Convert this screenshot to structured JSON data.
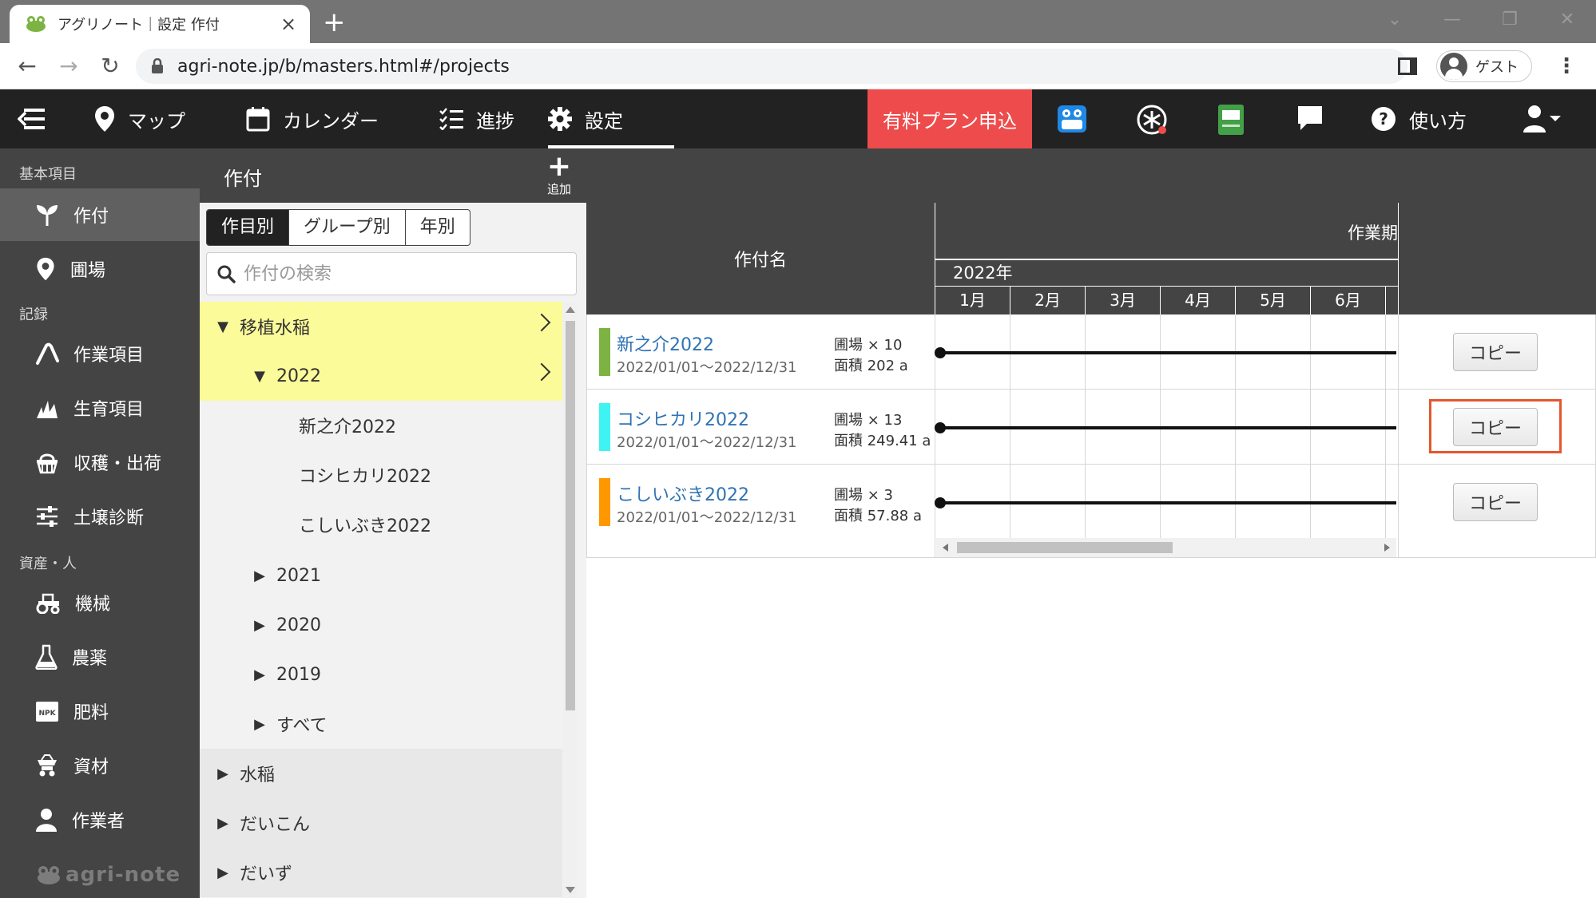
{
  "browser": {
    "tab_title": "アグリノート｜設定 作付",
    "url": "agri-note.jp/b/masters.html#/projects",
    "profile_label": "ゲスト"
  },
  "header": {
    "nav": [
      {
        "label": "マップ",
        "icon": "map-pin-icon"
      },
      {
        "label": "カレンダー",
        "icon": "calendar-icon"
      },
      {
        "label": "進捗",
        "icon": "checklist-icon"
      },
      {
        "label": "設定",
        "icon": "gear-icon",
        "active": true
      }
    ],
    "paid_plan_label": "有料プラン申込",
    "help_label": "使い方",
    "accent_red": "#ee4c4c"
  },
  "sidebar": {
    "sections": [
      {
        "title": "基本項目",
        "items": [
          {
            "label": "作付",
            "icon": "sprout-icon",
            "active": true
          },
          {
            "label": "圃場",
            "icon": "map-pin-icon"
          }
        ]
      },
      {
        "title": "記録",
        "items": [
          {
            "label": "作業項目",
            "icon": "work-icon"
          },
          {
            "label": "生育項目",
            "icon": "growth-icon"
          },
          {
            "label": "収穫・出荷",
            "icon": "basket-icon"
          },
          {
            "label": "土壌診断",
            "icon": "sliders-icon"
          }
        ]
      },
      {
        "title": "資産・人",
        "items": [
          {
            "label": "機械",
            "icon": "tractor-icon"
          },
          {
            "label": "農薬",
            "icon": "flask-icon"
          },
          {
            "label": "肥料",
            "icon": "npk-icon"
          },
          {
            "label": "資材",
            "icon": "material-icon"
          },
          {
            "label": "作業者",
            "icon": "person-icon"
          }
        ]
      }
    ],
    "logo_text": "agri-note"
  },
  "page": {
    "title": "作付",
    "add_label": "追加",
    "add_symbol": "+"
  },
  "tree_panel": {
    "tabs": [
      {
        "label": "作目別",
        "active": true
      },
      {
        "label": "グループ別"
      },
      {
        "label": "年別"
      }
    ],
    "search_placeholder": "作付の検索",
    "rows": [
      {
        "label": "移植水稲",
        "arrow": "▼",
        "level": 0,
        "highlight": true
      },
      {
        "label": "2022",
        "arrow": "▼",
        "level": 1,
        "highlight": true
      },
      {
        "label": "新之介2022",
        "arrow": "",
        "level": 2
      },
      {
        "label": "コシヒカリ2022",
        "arrow": "",
        "level": 2
      },
      {
        "label": "こしいぶき2022",
        "arrow": "",
        "level": 2
      },
      {
        "label": "2021",
        "arrow": "▶",
        "level": 1
      },
      {
        "label": "2020",
        "arrow": "▶",
        "level": 1
      },
      {
        "label": "2019",
        "arrow": "▶",
        "level": 1
      },
      {
        "label": "すべて",
        "arrow": "▶",
        "level": 1
      },
      {
        "label": "水稲",
        "arrow": "▶",
        "level": 0
      },
      {
        "label": "だいこん",
        "arrow": "▶",
        "level": 0
      },
      {
        "label": "だいず",
        "arrow": "▶",
        "level": 0
      }
    ]
  },
  "table": {
    "col_name_header": "作付名",
    "col_period_header": "作業期",
    "year_label": "2022年",
    "months": [
      "1月",
      "2月",
      "3月",
      "4月",
      "5月",
      "6月"
    ],
    "rows": [
      {
        "name": "新之介2022",
        "date_range": "2022/01/01～2022/12/31",
        "fields": "圃場 × 10",
        "area": "面積 202 a",
        "color": "#7cb342",
        "copy_label": "コピー"
      },
      {
        "name": "コシヒカリ2022",
        "date_range": "2022/01/01～2022/12/31",
        "fields": "圃場 × 13",
        "area": "面積 249.41 a",
        "color": "#3ff3f3",
        "copy_label": "コピー",
        "highlighted": true
      },
      {
        "name": "こしいぶき2022",
        "date_range": "2022/01/01～2022/12/31",
        "fields": "圃場 × 3",
        "area": "面積 57.88 a",
        "color": "#ff9800",
        "copy_label": "コピー"
      }
    ]
  }
}
